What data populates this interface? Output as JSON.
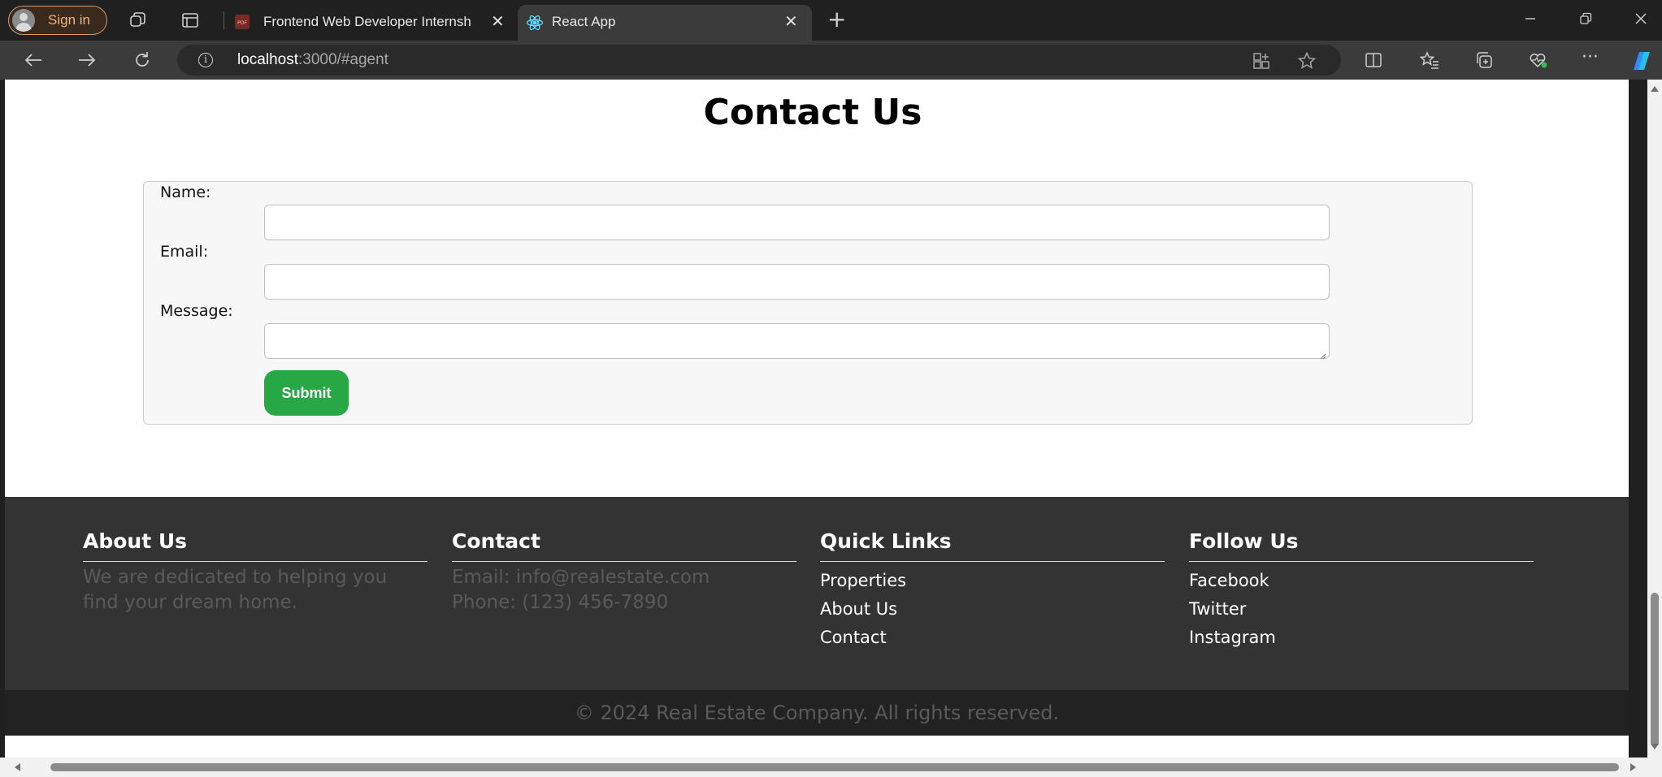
{
  "browser": {
    "profile": {
      "label": "Sign in"
    },
    "tabs": [
      {
        "title": "Frontend Web Developer Internsh",
        "favicon": "pdf-icon",
        "active": false
      },
      {
        "title": "React App",
        "favicon": "react-icon",
        "active": true
      }
    ],
    "url": {
      "host": "localhost",
      "path": ":3000/#agent"
    }
  },
  "page": {
    "title": "Contact Us",
    "form": {
      "name_label": "Name:",
      "email_label": "Email:",
      "message_label": "Message:",
      "name_value": "",
      "email_value": "",
      "message_value": "",
      "submit_label": "Submit",
      "accent_color": "#28a745"
    },
    "footer": {
      "about": {
        "heading": "About Us",
        "text": "We are dedicated to helping you find your dream home."
      },
      "contact": {
        "heading": "Contact",
        "email": "Email: info@realestate.com",
        "phone": "Phone: (123) 456-7890"
      },
      "quick_links": {
        "heading": "Quick Links",
        "items": [
          "Properties",
          "About Us",
          "Contact"
        ]
      },
      "follow": {
        "heading": "Follow Us",
        "items": [
          "Facebook",
          "Twitter",
          "Instagram"
        ]
      },
      "copyright": "© 2024 Real Estate Company. All rights reserved."
    }
  }
}
